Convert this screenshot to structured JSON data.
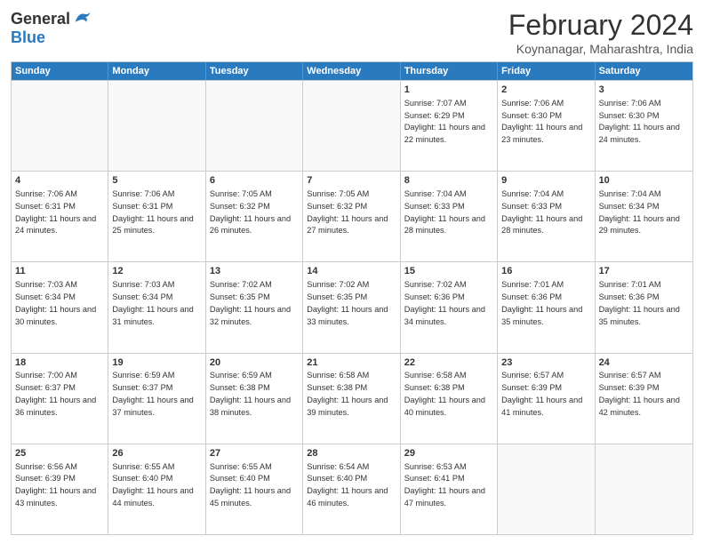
{
  "header": {
    "logo_general": "General",
    "logo_blue": "Blue",
    "month_title": "February 2024",
    "location": "Koynanagar, Maharashtra, India"
  },
  "weekdays": [
    "Sunday",
    "Monday",
    "Tuesday",
    "Wednesday",
    "Thursday",
    "Friday",
    "Saturday"
  ],
  "weeks": [
    [
      {
        "day": "",
        "empty": true
      },
      {
        "day": "",
        "empty": true
      },
      {
        "day": "",
        "empty": true
      },
      {
        "day": "",
        "empty": true
      },
      {
        "day": "1",
        "sunrise": "7:07 AM",
        "sunset": "6:29 PM",
        "daylight": "11 hours and 22 minutes."
      },
      {
        "day": "2",
        "sunrise": "7:06 AM",
        "sunset": "6:30 PM",
        "daylight": "11 hours and 23 minutes."
      },
      {
        "day": "3",
        "sunrise": "7:06 AM",
        "sunset": "6:30 PM",
        "daylight": "11 hours and 24 minutes."
      }
    ],
    [
      {
        "day": "4",
        "sunrise": "7:06 AM",
        "sunset": "6:31 PM",
        "daylight": "11 hours and 24 minutes."
      },
      {
        "day": "5",
        "sunrise": "7:06 AM",
        "sunset": "6:31 PM",
        "daylight": "11 hours and 25 minutes."
      },
      {
        "day": "6",
        "sunrise": "7:05 AM",
        "sunset": "6:32 PM",
        "daylight": "11 hours and 26 minutes."
      },
      {
        "day": "7",
        "sunrise": "7:05 AM",
        "sunset": "6:32 PM",
        "daylight": "11 hours and 27 minutes."
      },
      {
        "day": "8",
        "sunrise": "7:04 AM",
        "sunset": "6:33 PM",
        "daylight": "11 hours and 28 minutes."
      },
      {
        "day": "9",
        "sunrise": "7:04 AM",
        "sunset": "6:33 PM",
        "daylight": "11 hours and 28 minutes."
      },
      {
        "day": "10",
        "sunrise": "7:04 AM",
        "sunset": "6:34 PM",
        "daylight": "11 hours and 29 minutes."
      }
    ],
    [
      {
        "day": "11",
        "sunrise": "7:03 AM",
        "sunset": "6:34 PM",
        "daylight": "11 hours and 30 minutes."
      },
      {
        "day": "12",
        "sunrise": "7:03 AM",
        "sunset": "6:34 PM",
        "daylight": "11 hours and 31 minutes."
      },
      {
        "day": "13",
        "sunrise": "7:02 AM",
        "sunset": "6:35 PM",
        "daylight": "11 hours and 32 minutes."
      },
      {
        "day": "14",
        "sunrise": "7:02 AM",
        "sunset": "6:35 PM",
        "daylight": "11 hours and 33 minutes."
      },
      {
        "day": "15",
        "sunrise": "7:02 AM",
        "sunset": "6:36 PM",
        "daylight": "11 hours and 34 minutes."
      },
      {
        "day": "16",
        "sunrise": "7:01 AM",
        "sunset": "6:36 PM",
        "daylight": "11 hours and 35 minutes."
      },
      {
        "day": "17",
        "sunrise": "7:01 AM",
        "sunset": "6:36 PM",
        "daylight": "11 hours and 35 minutes."
      }
    ],
    [
      {
        "day": "18",
        "sunrise": "7:00 AM",
        "sunset": "6:37 PM",
        "daylight": "11 hours and 36 minutes."
      },
      {
        "day": "19",
        "sunrise": "6:59 AM",
        "sunset": "6:37 PM",
        "daylight": "11 hours and 37 minutes."
      },
      {
        "day": "20",
        "sunrise": "6:59 AM",
        "sunset": "6:38 PM",
        "daylight": "11 hours and 38 minutes."
      },
      {
        "day": "21",
        "sunrise": "6:58 AM",
        "sunset": "6:38 PM",
        "daylight": "11 hours and 39 minutes."
      },
      {
        "day": "22",
        "sunrise": "6:58 AM",
        "sunset": "6:38 PM",
        "daylight": "11 hours and 40 minutes."
      },
      {
        "day": "23",
        "sunrise": "6:57 AM",
        "sunset": "6:39 PM",
        "daylight": "11 hours and 41 minutes."
      },
      {
        "day": "24",
        "sunrise": "6:57 AM",
        "sunset": "6:39 PM",
        "daylight": "11 hours and 42 minutes."
      }
    ],
    [
      {
        "day": "25",
        "sunrise": "6:56 AM",
        "sunset": "6:39 PM",
        "daylight": "11 hours and 43 minutes."
      },
      {
        "day": "26",
        "sunrise": "6:55 AM",
        "sunset": "6:40 PM",
        "daylight": "11 hours and 44 minutes."
      },
      {
        "day": "27",
        "sunrise": "6:55 AM",
        "sunset": "6:40 PM",
        "daylight": "11 hours and 45 minutes."
      },
      {
        "day": "28",
        "sunrise": "6:54 AM",
        "sunset": "6:40 PM",
        "daylight": "11 hours and 46 minutes."
      },
      {
        "day": "29",
        "sunrise": "6:53 AM",
        "sunset": "6:41 PM",
        "daylight": "11 hours and 47 minutes."
      },
      {
        "day": "",
        "empty": true
      },
      {
        "day": "",
        "empty": true
      }
    ]
  ]
}
